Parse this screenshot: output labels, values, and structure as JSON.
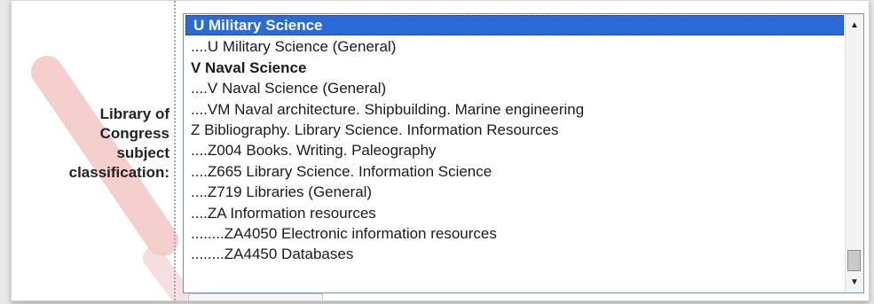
{
  "field": {
    "label_lines": [
      "Library of",
      "Congress",
      "subject",
      "classification:"
    ]
  },
  "listbox": {
    "options": [
      {
        "text": "U Military Science",
        "selected": true
      },
      {
        "text": "....U Military Science (General)"
      },
      {
        "text": "V Naval Science",
        "heading": true
      },
      {
        "text": "....V Naval Science (General)"
      },
      {
        "text": "....VM Naval architecture. Shipbuilding. Marine engineering"
      },
      {
        "text": "Z Bibliography. Library Science. Information Resources"
      },
      {
        "text": "....Z004 Books. Writing. Paleography"
      },
      {
        "text": "....Z665 Library Science. Information Science"
      },
      {
        "text": "....Z719 Libraries (General)"
      },
      {
        "text": "....ZA Information resources"
      },
      {
        "text": "........ZA4050 Electronic information resources"
      },
      {
        "text": "........ZA4450 Databases"
      }
    ],
    "scroll_position": 0.92
  },
  "colors": {
    "selection": "#2a6ad9",
    "watermark": "#f4c9c9"
  },
  "icons": {
    "scroll_up": "triangle-up",
    "scroll_down": "triangle-down"
  }
}
